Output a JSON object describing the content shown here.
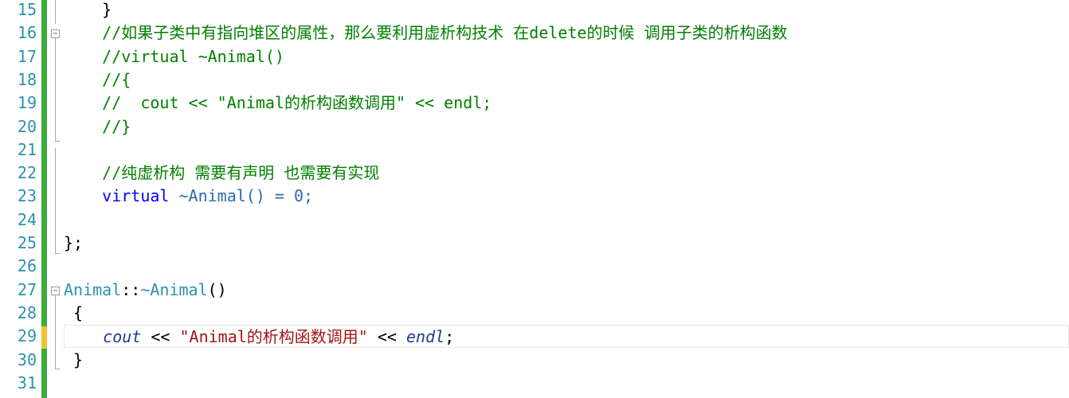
{
  "editor": {
    "lines": [
      {
        "num": "15",
        "text": "    }"
      },
      {
        "num": "16",
        "text": "    //如果子类中有指向堆区的属性，那么要利用虚析构技术 在delete的时候 调用子类的析构函数"
      },
      {
        "num": "17",
        "text": "    //virtual ~Animal()"
      },
      {
        "num": "18",
        "text": "    //{"
      },
      {
        "num": "19",
        "text": "    //  cout << \"Animal的析构函数调用\" << endl;"
      },
      {
        "num": "20",
        "text": "    //}"
      },
      {
        "num": "21",
        "text": ""
      },
      {
        "num": "22",
        "text": "    //纯虚析构 需要有声明 也需要有实现"
      },
      {
        "num": "23",
        "kw": "virtual",
        "rest": " ~Animal() = 0;"
      },
      {
        "num": "24",
        "text": ""
      },
      {
        "num": "25",
        "text": "};"
      },
      {
        "num": "26",
        "text": ""
      },
      {
        "num": "27",
        "cls": "Animal",
        "sep": "::",
        "dtor": "~Animal",
        "rest": "()"
      },
      {
        "num": "28",
        "text": "{"
      },
      {
        "num": "29",
        "cout": "cout",
        "op1": " << ",
        "str": "\"Animal的析构函数调用\"",
        "op2": " << ",
        "endl": "endl",
        "semi": ";"
      },
      {
        "num": "30",
        "text": "}"
      },
      {
        "num": "31",
        "text": ""
      }
    ]
  },
  "colors": {
    "line_number": "#2b91af",
    "comment": "#008000",
    "keyword": "#0000ff",
    "string": "#a31515",
    "change_bar_saved": "#3cab3c",
    "change_bar_unsaved": "#f1c232"
  }
}
